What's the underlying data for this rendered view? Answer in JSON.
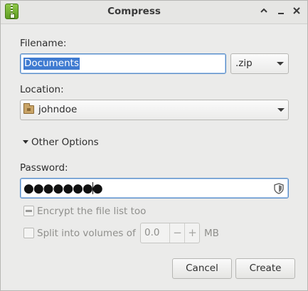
{
  "window": {
    "title": "Compress",
    "controls": [
      "chevron-up-icon",
      "minimize-icon",
      "close-icon"
    ],
    "minimize_glyph": "—",
    "close_glyph": "✕",
    "maximize_glyph": "^"
  },
  "filename": {
    "label": "Filename:",
    "value": "Documents",
    "extension": ".zip"
  },
  "location": {
    "label": "Location:",
    "value": "johndoe",
    "icon": "home-folder-icon"
  },
  "options": {
    "expander_label": "Other Options",
    "expanded": true,
    "password_label": "Password:",
    "password_mask": "●●●●●●●●",
    "encrypt_label": "Encrypt the file list too",
    "split_label": "Split into volumes of",
    "split_value": "0.0",
    "split_unit": "MB",
    "spin_minus": "−",
    "spin_plus": "+"
  },
  "buttons": {
    "cancel": "Cancel",
    "create": "Create"
  },
  "colors": {
    "selection": "#3f7bd1",
    "focus_border": "#5b8ec7",
    "app_icon": "#6aa82c"
  }
}
